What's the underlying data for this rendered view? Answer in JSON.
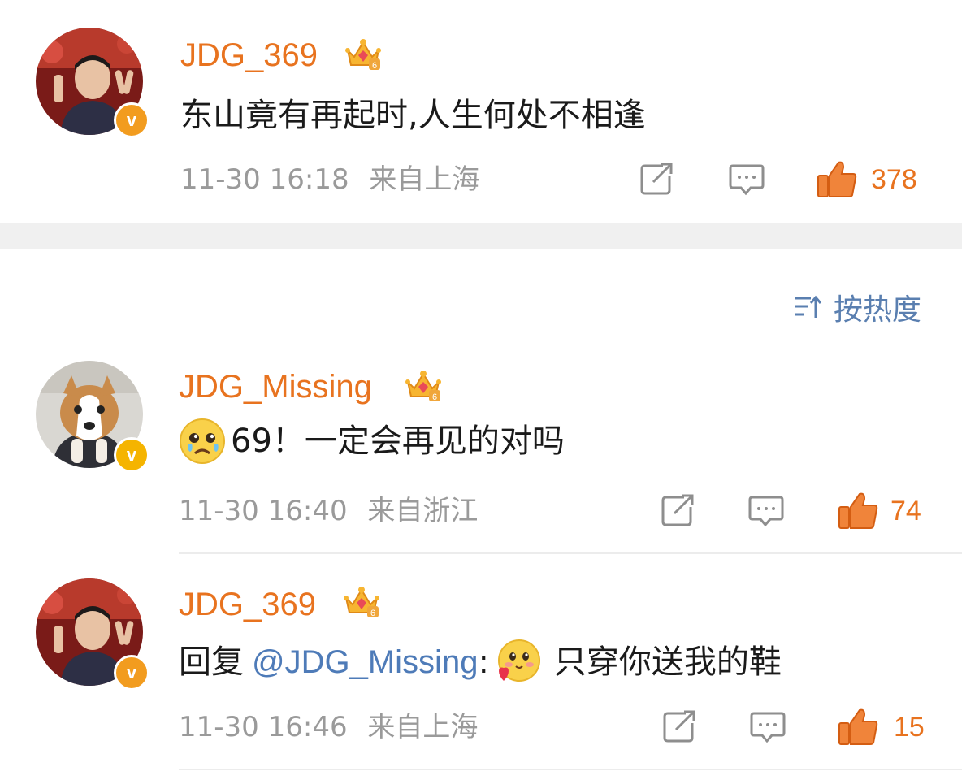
{
  "comments": [
    {
      "username": "JDG_369",
      "content": "东山竟有再起时,人生何处不相逢",
      "time": "11-30 16:18",
      "location": "来自上海",
      "likes": "378",
      "verified_color": "#f29c1f"
    },
    {
      "username": "JDG_Missing",
      "content_prefix": "69！一定会再见的对吗",
      "time": "11-30 16:40",
      "location": "来自浙江",
      "likes": "74",
      "verified_color": "#f5b400",
      "emoji": "crying-face-emoji"
    },
    {
      "username": "JDG_369",
      "reply_prefix": "回复",
      "mention": "@JDG_Missing",
      "colon": ":",
      "content": "只穿你送我的鞋",
      "time": "11-30 16:46",
      "location": "来自上海",
      "likes": "15",
      "verified_color": "#f29c1f",
      "emoji": "blushing-heart-emoji"
    }
  ],
  "sort": {
    "label": "按热度"
  },
  "icons": {
    "share": "share-icon",
    "comment": "comment-icon",
    "like": "thumbs-up-icon",
    "crown": "crown-badge-icon",
    "sort": "sort-icon"
  },
  "colors": {
    "username": "#e8731f",
    "mention": "#4e7bb8",
    "meta": "#9a9a9a",
    "like": "#e8731f"
  }
}
